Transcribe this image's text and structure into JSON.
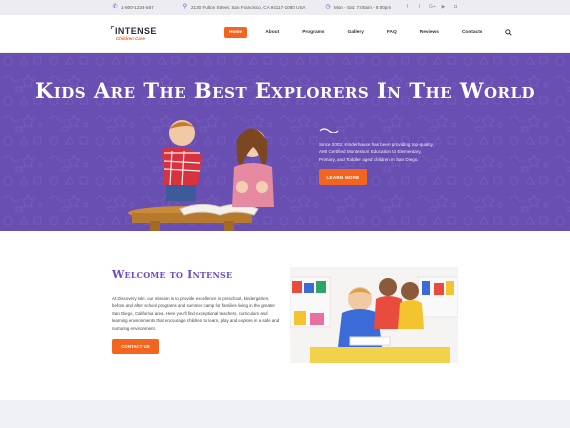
{
  "topbar": {
    "phone": "1-800-1234-567",
    "address": "2130 Fulton Street, San Francisco, CA 94117-1080 USA",
    "hours": "Mon - Sat: 7:00am - 8:00pm",
    "socials": [
      {
        "icon": "facebook-icon",
        "glyph": "f"
      },
      {
        "icon": "twitter-icon",
        "glyph": "t"
      },
      {
        "icon": "google-plus-icon",
        "glyph": "G+"
      },
      {
        "icon": "youtube-icon",
        "glyph": "▶"
      },
      {
        "icon": "instagram-icon",
        "glyph": "◘"
      }
    ]
  },
  "logo": {
    "name": "INTENSE",
    "tagline": "Children Care"
  },
  "nav": {
    "items": [
      "Home",
      "About",
      "Programs",
      "Gallery",
      "FAQ",
      "Reviews",
      "Contacts"
    ],
    "active": "Home"
  },
  "hero": {
    "title": "Kids Are The Best Explorers In The World",
    "text": "Since 2003, Kinderhause has been providing top-quality, AMI Certified Montessori Education to Elementary, Primary, and Toddler aged children in San Diego.",
    "button": "LEARN MORE"
  },
  "welcome": {
    "title": "Welcome to Intense",
    "text": "At Discovery Isle, our mission is to provide excellence in preschool, kindergarten, before and after school programs and summer camp for families living in the greater San Diego, California area. Here you'll find exceptional teachers, curriculum and learning environments that encourage children to learn, play and explore in a safe and nurturing environment.",
    "button": "CONTACT US"
  },
  "colors": {
    "accent": "#f2651f",
    "purple": "#6a4fb2",
    "topbar": "#ededf1"
  }
}
